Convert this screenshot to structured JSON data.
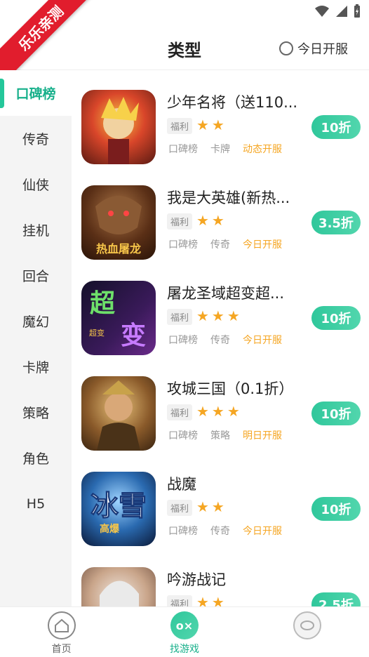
{
  "ribbon": "乐乐亲测",
  "header": {
    "title": "类型",
    "today_toggle_label": "今日开服"
  },
  "sidebar": {
    "items": [
      {
        "label": "口碑榜",
        "active": true
      },
      {
        "label": "传奇"
      },
      {
        "label": "仙侠"
      },
      {
        "label": "挂机"
      },
      {
        "label": "回合"
      },
      {
        "label": "魔幻"
      },
      {
        "label": "卡牌"
      },
      {
        "label": "策略"
      },
      {
        "label": "角色"
      },
      {
        "label": "H5"
      }
    ]
  },
  "games": [
    {
      "name": "少年名将（送110...",
      "fuli": "福利",
      "stars": "★★",
      "tag1": "口碑榜",
      "tag2": "卡牌",
      "open": "动态开服",
      "discount": "10折"
    },
    {
      "name": "我是大英雄(新热...",
      "fuli": "福利",
      "stars": "★★",
      "tag1": "口碑榜",
      "tag2": "传奇",
      "open": "今日开服",
      "discount": "3.5折"
    },
    {
      "name": "屠龙圣域超变超...",
      "fuli": "福利",
      "stars": "★★★",
      "tag1": "口碑榜",
      "tag2": "传奇",
      "open": "今日开服",
      "discount": "10折"
    },
    {
      "name": "攻城三国（0.1折）",
      "fuli": "福利",
      "stars": "★★★",
      "tag1": "口碑榜",
      "tag2": "策略",
      "open": "明日开服",
      "discount": "10折"
    },
    {
      "name": "战魔",
      "fuli": "福利",
      "stars": "★★",
      "tag1": "口碑榜",
      "tag2": "传奇",
      "open": "今日开服",
      "discount": "10折"
    },
    {
      "name": "吟游战记",
      "fuli": "福利",
      "stars": "★★",
      "tag1": "",
      "tag2": "",
      "open": "",
      "discount": "2.5折"
    }
  ],
  "icon_texts": {
    "g2": "热血屠龙",
    "g3_big1": "超",
    "g3_big2": "变",
    "g3_small": "超变",
    "g5_big": "冰雪",
    "g5_small": "高爆"
  },
  "bottom_nav": {
    "home": "首页",
    "find": "找游戏",
    "find_icon": "o×",
    "me": ""
  },
  "colors": {
    "accent": "#24c79a",
    "star": "#f5a623",
    "ribbon": "#e11d2d"
  }
}
